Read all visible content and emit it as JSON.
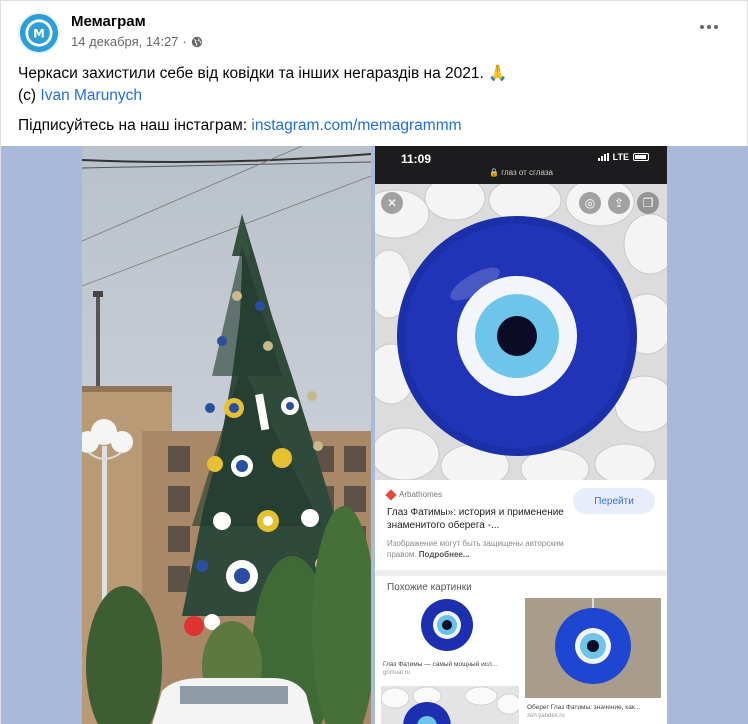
{
  "post": {
    "page_name": "Мемаграм",
    "timestamp": "14 декабря, 14:27",
    "separator": "·",
    "icons": {
      "privacy": "globe-icon",
      "more": "more-options-icon"
    },
    "text": {
      "line1": "Черкаси захистили себе від ковідки та інших негараздів на 2021.",
      "emoji": "🙏",
      "credit_prefix": "(с) ",
      "credit_name": "Ivan Marunych",
      "cta_prefix": "Підписуйтесь на наш інстаграм: ",
      "cta_link": "instagram.com/memagrammm"
    },
    "colors": {
      "link": "#216fdb",
      "meta": "#65676b",
      "media_bg": "#a9b9d9"
    }
  },
  "phone": {
    "time": "11:09",
    "network": "LTE",
    "search_query": "🔒 глаз от сглаза",
    "result": {
      "source": "Arbathomes",
      "title": "Глаз Фатимы»: история и применение знаменитого оберега -...",
      "button": "Перейти",
      "note": "Изображение могут быть защищены авторским правом.",
      "note_more": "Подробнее..."
    },
    "similar_title": "Похожие картинки",
    "thumbs": [
      {
        "caption": "Глаз Фатимы — самый мощный исл...",
        "source": "grimuar.ru"
      },
      {
        "caption": "Оберег Глаз Фатимы: значение, как...",
        "source": "zen.yandex.ru"
      }
    ]
  }
}
